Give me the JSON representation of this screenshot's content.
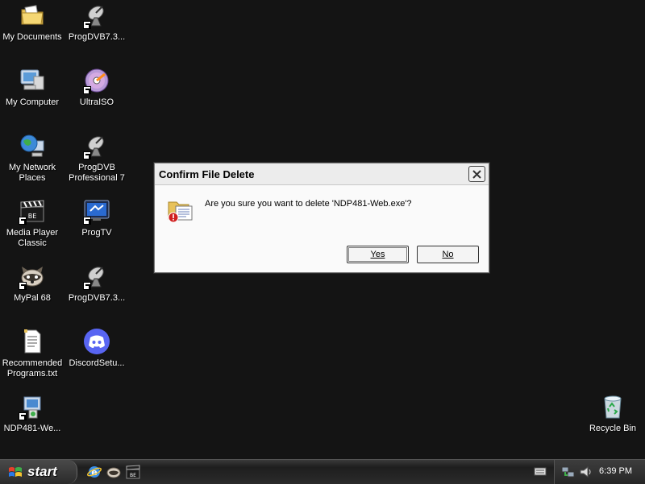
{
  "desktop": {
    "icons": [
      {
        "label": "My Documents",
        "icon": "folder-documents-icon"
      },
      {
        "label": "ProgDVB7.3...",
        "icon": "satellite-dish-icon"
      },
      {
        "label": "My Computer",
        "icon": "computer-icon"
      },
      {
        "label": "UltraISO",
        "icon": "disc-icon"
      },
      {
        "label": "My Network\nPlaces",
        "icon": "network-globe-icon"
      },
      {
        "label": "ProgDVB\nProfessional 7",
        "icon": "satellite-dish-icon"
      },
      {
        "label": "Media Player\nClassic",
        "icon": "clapperboard-icon"
      },
      {
        "label": "ProgTV",
        "icon": "tv-icon"
      },
      {
        "label": "MyPal 68",
        "icon": "raccoon-icon"
      },
      {
        "label": "ProgDVB7.3...",
        "icon": "satellite-dish-icon"
      },
      {
        "label": "Recommended\nPrograms.txt",
        "icon": "text-file-icon"
      },
      {
        "label": "DiscordSetu...",
        "icon": "discord-icon"
      },
      {
        "label": "NDP481-We...",
        "icon": "installer-icon"
      },
      {
        "label": "Recycle Bin",
        "icon": "recycle-bin-icon"
      }
    ]
  },
  "dialog": {
    "title": "Confirm File Delete",
    "message": "Are you sure you want to delete 'NDP481-Web.exe'?",
    "yes_label": "Yes",
    "no_label": "No",
    "icon": "file-delete-warning-icon"
  },
  "taskbar": {
    "start_label": "start",
    "quick_launch": [
      "internet-explorer-icon",
      "raccoon-icon",
      "clapperboard-icon"
    ],
    "tray_icons": [
      "keyboard-icon",
      "network-icon",
      "volume-icon"
    ],
    "clock": "6:39 PM"
  },
  "colors": {
    "desktop_bg": "#141414",
    "dialog_bg": "#fafafa",
    "taskbar": "#2b2b2b"
  }
}
